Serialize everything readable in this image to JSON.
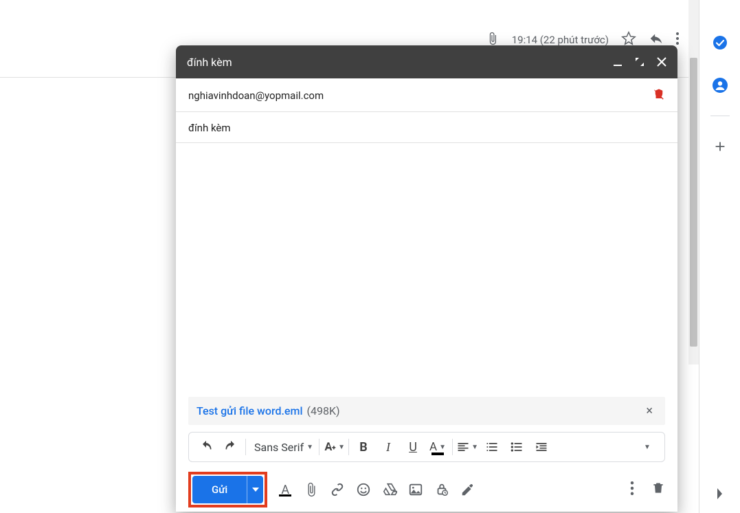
{
  "email_row": {
    "time_text": "19:14 (22 phút trước)"
  },
  "compose": {
    "window_title": "đính kèm",
    "recipient": "nghiavinhdoan@yopmail.com",
    "subject": "đính kèm",
    "attachment": {
      "filename": "Test gửi file word.eml",
      "size_label": "(498K)"
    },
    "send_label": "Gửi",
    "font_name": "Sans Serif"
  },
  "icons": {
    "tasks": "tasks-icon",
    "contacts": "contacts-icon",
    "add": "add-icon"
  }
}
